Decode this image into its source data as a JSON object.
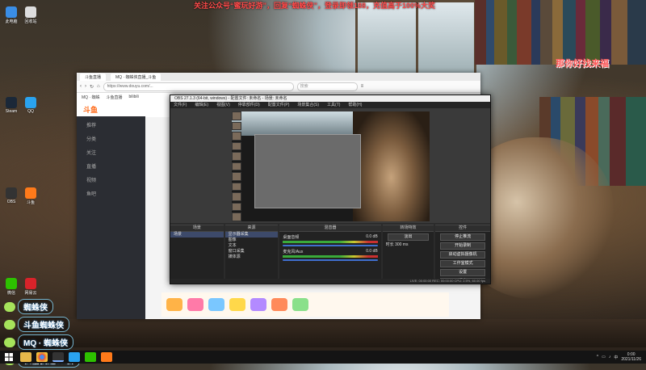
{
  "overlay": {
    "promo_banner": "关注公众号“蜜玩好游”，回复“蜘蛛侠”，登录即领188，充值高于100%大奖",
    "corner_watermark": "那你好找来福",
    "chat_lines": [
      {
        "text": "蜘蛛侠",
        "icon": "wechat-icon"
      },
      {
        "text": "斗鱼蜘蛛侠",
        "icon": "chat-bubble-icon"
      },
      {
        "text": "MQ · 蜘蛛侠",
        "icon": "chat-bubble-icon"
      },
      {
        "text": "私信我进VX群",
        "icon": "chat-bubble-icon"
      }
    ]
  },
  "desktop": {
    "icons": [
      {
        "label": "此电脑",
        "color": "#3a8ee6"
      },
      {
        "label": "回收站",
        "color": "#dddddd"
      },
      {
        "label": "Steam",
        "color": "#1b2838"
      },
      {
        "label": "QQ",
        "color": "#2aa3ef"
      },
      {
        "label": "OBS",
        "color": "#333333"
      },
      {
        "label": "斗鱼",
        "color": "#ff7a1a"
      },
      {
        "label": "微信",
        "color": "#2dc100"
      },
      {
        "label": "网易云",
        "color": "#d8232a"
      }
    ]
  },
  "browser": {
    "tabs": [
      "斗鱼直播",
      "MQ · 蜘蛛侠直播_斗鱼"
    ],
    "url": "https://www.douyu.com/...",
    "search_placeholder": "搜索",
    "bookmarks": [
      "MQ · 蜘蛛",
      "斗鱼直播",
      "bilibili"
    ],
    "site_logo": "斗鱼",
    "sidebar_items": [
      "推荐",
      "分类",
      "关注",
      "直播",
      "视频",
      "鱼吧"
    ]
  },
  "obs": {
    "title": "OBS 27.1.3 (64-bit, windows) - 配置文件: 未命名 - 场景: 未命名",
    "menu": [
      "文件(F)",
      "编辑(E)",
      "视图(V)",
      "停靠部件(D)",
      "配置文件(P)",
      "场景集合(S)",
      "工具(T)",
      "帮助(H)"
    ],
    "docks": {
      "scenes": {
        "title": "场景",
        "items": [
          "场景"
        ]
      },
      "sources": {
        "title": "来源",
        "items": [
          "显示器采集",
          "图像",
          "文本",
          "窗口采集",
          "媒体源"
        ]
      },
      "mixer": {
        "title": "混音器",
        "tracks": [
          {
            "name": "桌面音频",
            "db": "0.0 dB"
          },
          {
            "name": "麦克风/Aux",
            "db": "0.0 dB"
          }
        ]
      },
      "transitions": {
        "title": "转场特效",
        "type": "淡出",
        "duration_label": "时长",
        "duration": "300 ms"
      },
      "controls": {
        "title": "控件",
        "buttons": [
          "停止推流",
          "开始录制",
          "启动虚拟摄像机",
          "工作室模式",
          "设置",
          "退出"
        ]
      }
    },
    "status": "LIVE: 00:00:00  REC: 00:00:00  CPU: 2.5%, 60.00 fps"
  },
  "taskbar": {
    "apps": [
      "文件资源管理器",
      "谷歌浏览器",
      "OBS",
      "QQ",
      "微信",
      "斗鱼"
    ],
    "time": "0:00",
    "date": "2021/11/26"
  }
}
